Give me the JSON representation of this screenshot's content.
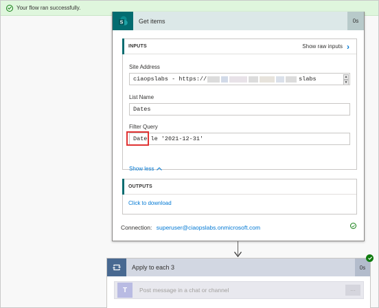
{
  "banner": {
    "message": "Your flow ran successfully."
  },
  "get_items": {
    "title": "Get items",
    "duration": "0s",
    "inputs": {
      "header": "INPUTS",
      "show_raw": "Show raw inputs",
      "site_address": {
        "label": "Site Address",
        "value_start": "ciaopslabs - https://",
        "value_end": "slabs"
      },
      "list_name": {
        "label": "List Name",
        "value": "Dates"
      },
      "filter_query": {
        "label": "Filter Query",
        "field": "Date",
        "rest": " le '2021-12-31'"
      },
      "show_less": "Show less"
    },
    "outputs": {
      "header": "OUTPUTS",
      "download": "Click to download"
    },
    "connection": {
      "label": "Connection:",
      "value": "superuser@ciaopslabs.onmicrosoft.com"
    }
  },
  "apply_to_each": {
    "title": "Apply to each 3",
    "duration": "0s",
    "inner_action": "Post message in a chat or channel",
    "more": "···"
  },
  "colors": {
    "sharepoint": "#036c70",
    "loop": "#486991",
    "success": "#107c10",
    "link": "#0078d4",
    "highlight": "#e03131"
  }
}
